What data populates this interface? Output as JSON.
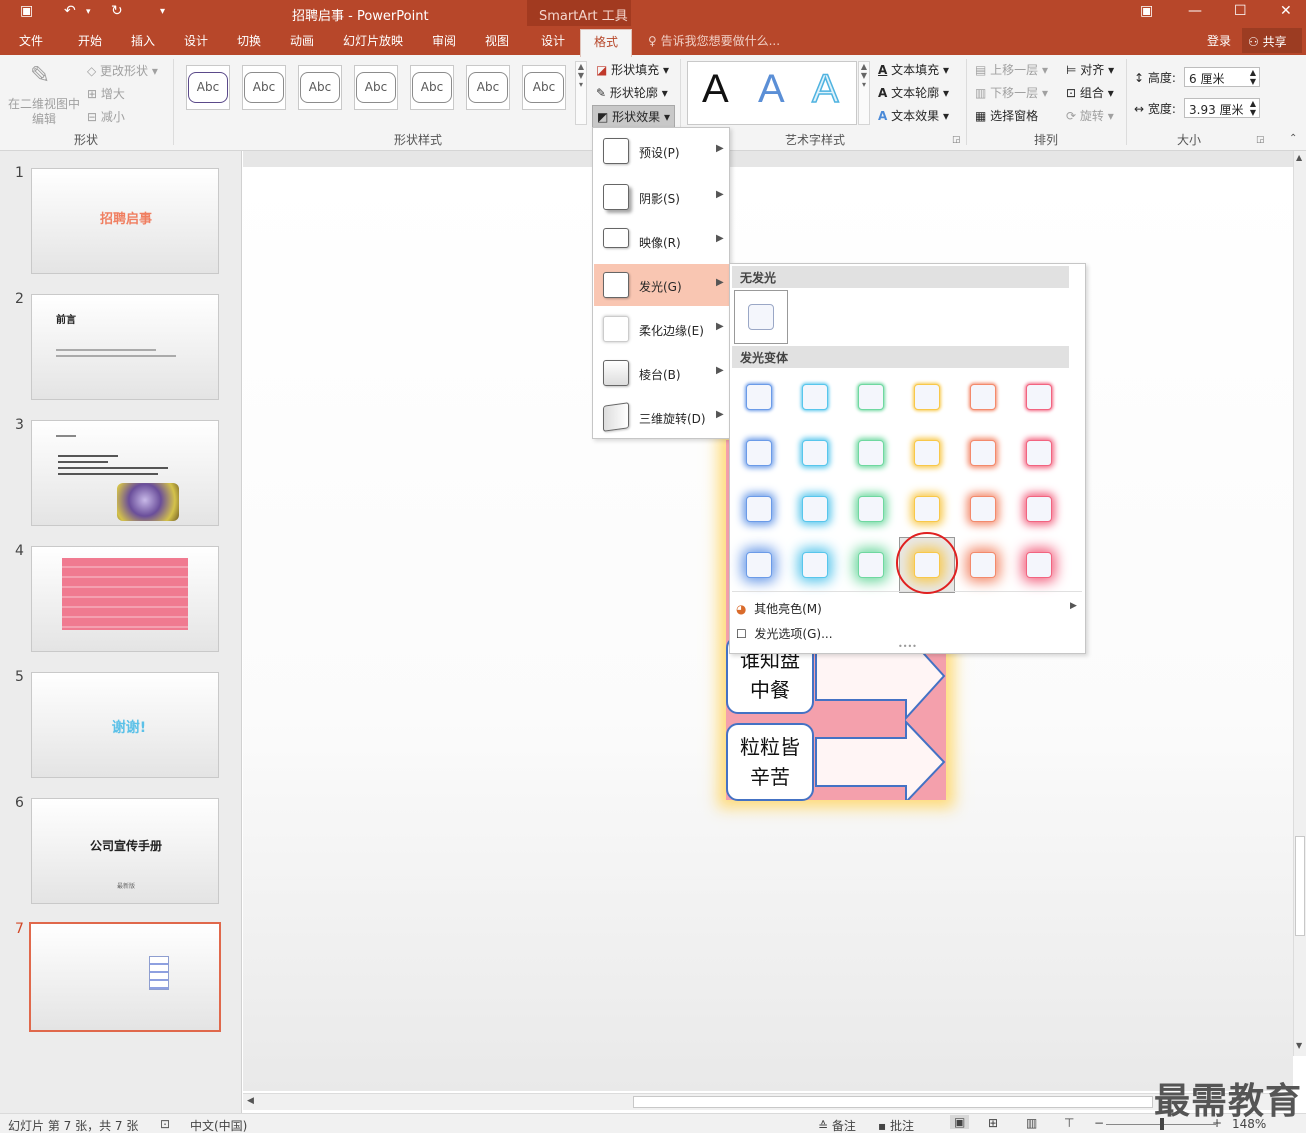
{
  "app": {
    "doc_title": "招聘启事 - PowerPoint",
    "context_tools": "SmartArt 工具"
  },
  "tabs": [
    "文件",
    "开始",
    "插入",
    "设计",
    "切换",
    "动画",
    "幻灯片放映",
    "审阅",
    "视图",
    "设计",
    "格式"
  ],
  "tell_me": "告诉我您想要做什么...",
  "login": "登录",
  "share": "共享",
  "ribbon": {
    "shapes_group": {
      "edit_2d": "在二维视图中编辑",
      "change_shape": "更改形状",
      "larger": "增大",
      "smaller": "减小",
      "label": "形状"
    },
    "shape_styles": {
      "label": "形状样式",
      "items": [
        "Abc",
        "Abc",
        "Abc",
        "Abc",
        "Abc",
        "Abc",
        "Abc"
      ],
      "fill": "形状填充",
      "outline": "形状轮廓",
      "effects": "形状效果"
    },
    "wordart": {
      "label": "艺术字样式",
      "letter": "A",
      "text_fill": "文本填充",
      "text_outline": "文本轮廓",
      "text_effects": "文本效果"
    },
    "arrange": {
      "label": "排列",
      "bring_forward": "上移一层",
      "send_backward": "下移一层",
      "selection_pane": "选择窗格",
      "align": "对齐",
      "group": "组合",
      "rotate": "旋转"
    },
    "size": {
      "label": "大小",
      "height_label": "高度:",
      "height_value": "6 厘米",
      "width_label": "宽度:",
      "width_value": "3.93 厘米"
    }
  },
  "slides": [
    {
      "num": "1",
      "title": "招聘启事"
    },
    {
      "num": "2",
      "title": "前言"
    },
    {
      "num": "3",
      "title": ""
    },
    {
      "num": "4",
      "title": ""
    },
    {
      "num": "5",
      "title": "谢谢!"
    },
    {
      "num": "6",
      "title": "公司宣传手册",
      "subtitle": "最新版"
    },
    {
      "num": "7",
      "title": ""
    }
  ],
  "slide_content": {
    "boxes": [
      "谁知盘中餐",
      "粒粒皆辛苦"
    ]
  },
  "effects_menu": {
    "items": [
      {
        "label": "预设(P)"
      },
      {
        "label": "阴影(S)"
      },
      {
        "label": "映像(R)"
      },
      {
        "label": "发光(G)"
      },
      {
        "label": "柔化边缘(E)"
      },
      {
        "label": "棱台(B)"
      },
      {
        "label": "三维旋转(D)"
      }
    ],
    "highlighted_index": 3
  },
  "glow_gallery": {
    "no_glow": "无发光",
    "variants": "发光变体",
    "colors": [
      "#6b9be8",
      "#58c6ec",
      "#6fd8a0",
      "#f8c84a",
      "#f38a6c",
      "#f26480"
    ],
    "rows": 4,
    "selected": {
      "row": 3,
      "col": 3
    },
    "more_colors": "其他亮色(M)",
    "glow_options": "发光选项(G)..."
  },
  "status": {
    "slide_info": "幻灯片 第 7 张，共 7 张",
    "language": "中文(中国)",
    "notes": "备注",
    "comments": "批注",
    "zoom": "148%"
  },
  "watermark": "最需教育"
}
